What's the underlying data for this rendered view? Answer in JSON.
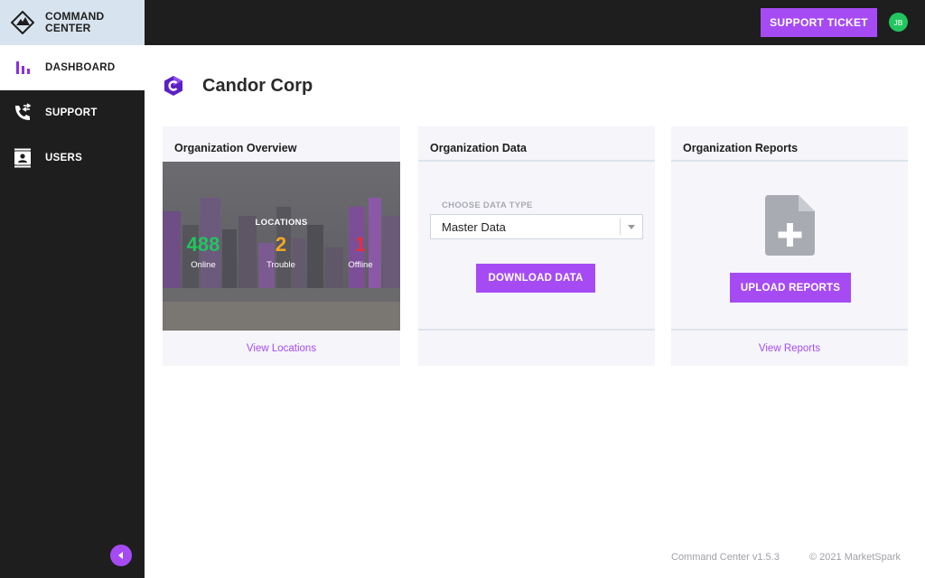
{
  "app": {
    "brand_line1": "COMMAND",
    "brand_line2": "CENTER"
  },
  "sidebar": {
    "items": [
      {
        "label": "DASHBOARD",
        "icon": "bar-chart-icon",
        "active": true
      },
      {
        "label": "SUPPORT",
        "icon": "phone-transfer-icon",
        "active": false
      },
      {
        "label": "USERS",
        "icon": "contact-card-icon",
        "active": false
      }
    ],
    "collapse_icon": "chevron-left-icon"
  },
  "topbar": {
    "support_button": "SUPPORT TICKET",
    "avatar_initials": "JB"
  },
  "header": {
    "org_name": "Candor Corp",
    "org_logo": "c-hexagon-logo"
  },
  "cards": {
    "overview": {
      "title": "Organization Overview",
      "locations_label": "LOCATIONS",
      "stats": [
        {
          "value": "488",
          "label": "Online",
          "color": "#22c55e"
        },
        {
          "value": "2",
          "label": "Trouble",
          "color": "#f5a623"
        },
        {
          "value": "1",
          "label": "Offline",
          "color": "#e5303a"
        }
      ],
      "link": "View Locations"
    },
    "data": {
      "title": "Organization Data",
      "field_label": "CHOOSE DATA TYPE",
      "selected_value": "Master Data",
      "button": "DOWNLOAD DATA"
    },
    "reports": {
      "title": "Organization Reports",
      "icon": "file-add-icon",
      "button": "UPLOAD REPORTS",
      "link": "View Reports"
    }
  },
  "footer": {
    "version": "Command Center v1.5.3",
    "copyright": "© 2021 MarketSpark"
  },
  "colors": {
    "accent": "#a64bf4",
    "sidebar_bg": "#1e1e1e",
    "brand_bg": "#d7e3ee",
    "card_bg": "#f5f5fa"
  }
}
